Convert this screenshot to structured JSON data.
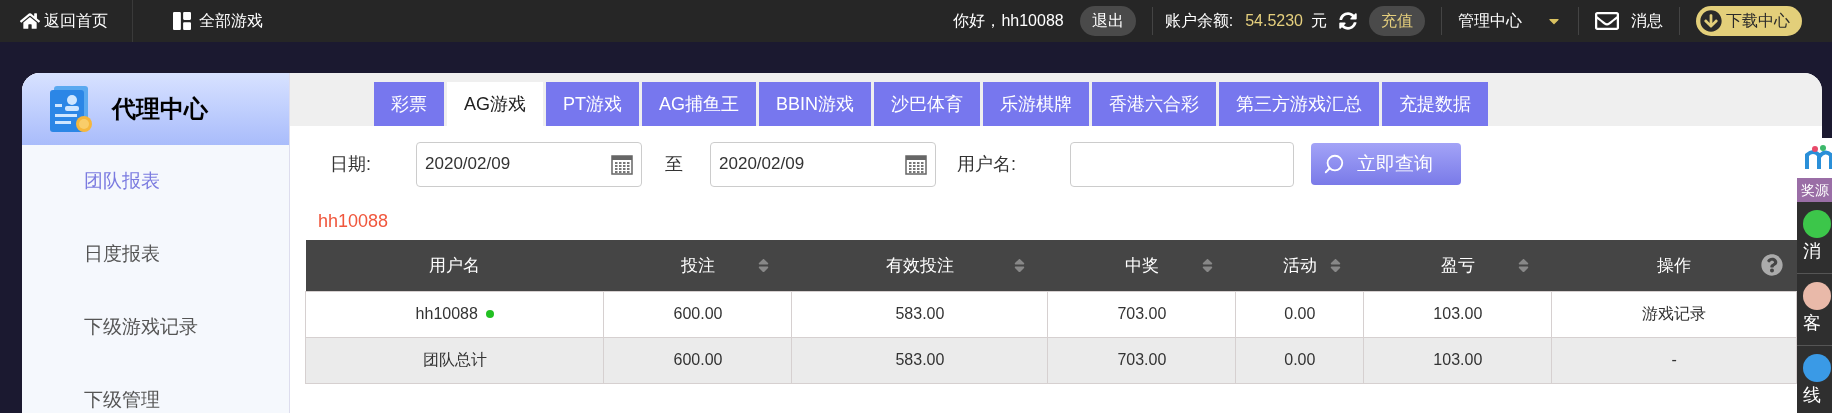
{
  "top_bar": {
    "home": "返回首页",
    "all_games": "全部游戏",
    "greeting": "你好，hh10088",
    "logout": "退出",
    "balance_label": "账户余额:",
    "balance": "54.5230",
    "currency": "元",
    "recharge": "充值",
    "manage": "管理中心",
    "messages": "消息",
    "download": "下载中心"
  },
  "sidebar": {
    "title": "代理中心",
    "items": [
      {
        "label": "团队报表",
        "selected": true
      },
      {
        "label": "日度报表",
        "selected": false
      },
      {
        "label": "下级游戏记录",
        "selected": false
      },
      {
        "label": "下级管理",
        "selected": false
      }
    ]
  },
  "tabs": [
    {
      "label": "彩票",
      "selected": false
    },
    {
      "label": "AG游戏",
      "selected": true
    },
    {
      "label": "PT游戏",
      "selected": false
    },
    {
      "label": "AG捕鱼王",
      "selected": false
    },
    {
      "label": "BBIN游戏",
      "selected": false
    },
    {
      "label": "沙巴体育",
      "selected": false
    },
    {
      "label": "乐游棋牌",
      "selected": false
    },
    {
      "label": "香港六合彩",
      "selected": false
    },
    {
      "label": "第三方游戏汇总",
      "selected": false
    },
    {
      "label": "充提数据",
      "selected": false
    }
  ],
  "filter": {
    "date_label": "日期:",
    "date_from": "2020/02/09",
    "to_label": "至",
    "date_to": "2020/02/09",
    "username_label": "用户名:",
    "search_button": "立即查询"
  },
  "current_user": "hh10088",
  "table": {
    "columns": [
      {
        "label": "用户名",
        "sortable": false
      },
      {
        "label": "投注",
        "sortable": true
      },
      {
        "label": "有效投注",
        "sortable": true
      },
      {
        "label": "中奖",
        "sortable": true
      },
      {
        "label": "活动",
        "sortable": true
      },
      {
        "label": "盈亏",
        "sortable": true
      },
      {
        "label": "操作",
        "sortable": false,
        "help": true
      }
    ],
    "rows": [
      {
        "kind": "user",
        "cells": [
          "hh10088",
          "600.00",
          "583.00",
          "703.00",
          "0.00",
          "103.00",
          "游戏记录"
        ],
        "online": true
      },
      {
        "kind": "total",
        "cells": [
          "团队总计",
          "600.00",
          "583.00",
          "703.00",
          "0.00",
          "103.00",
          "-"
        ],
        "online": false
      }
    ]
  },
  "side_widget": {
    "banner": "奖源",
    "items": [
      "消",
      "客",
      "线"
    ]
  }
}
